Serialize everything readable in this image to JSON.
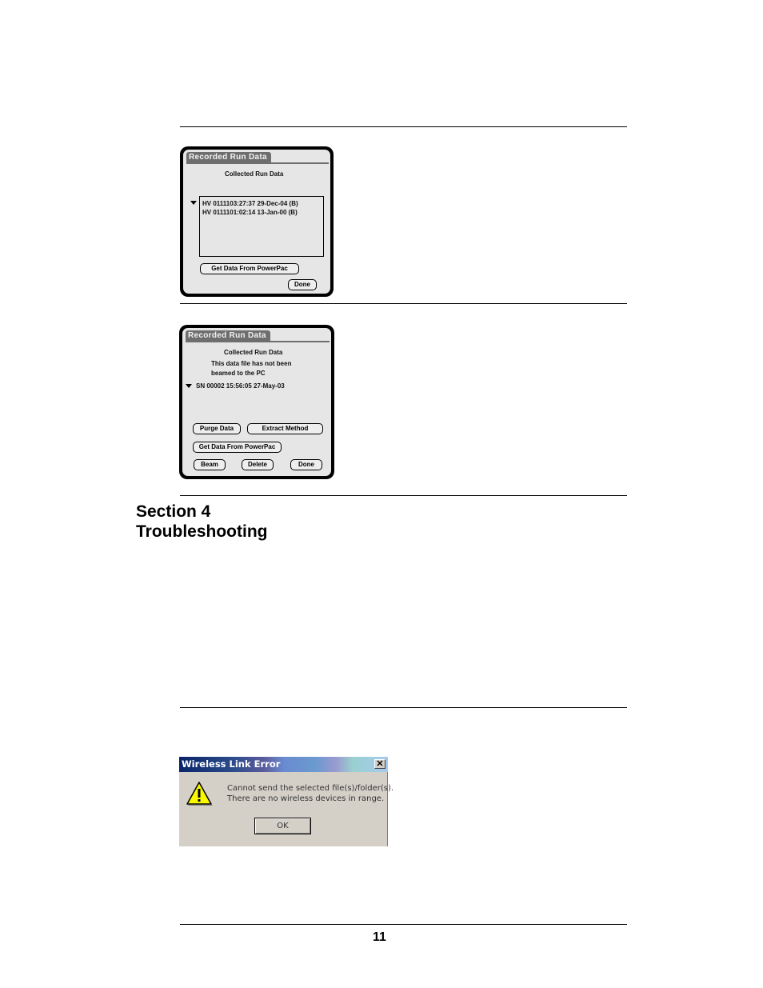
{
  "palm_dialog_1": {
    "title": "Recorded Run Data",
    "subtitle": "Collected Run Data",
    "list_items": [
      "HV 0111103:27:37 29-Dec-04 (B)",
      "HV 0111101:02:14 13-Jan-00 (B)"
    ],
    "get_data_button": "Get Data From PowerPac",
    "done_button": "Done"
  },
  "palm_dialog_2": {
    "title": "Recorded Run Data",
    "subtitle": "Collected Run Data",
    "notice_line1": "This data file has not been",
    "notice_line2": "beamed to the PC",
    "selected_file": "SN 00002  15:56:05 27-May-03",
    "purge_button": "Purge Data",
    "extract_button": "Extract Method",
    "get_data_button": "Get Data From PowerPac",
    "beam_button": "Beam",
    "delete_button": "Delete",
    "done_button": "Done"
  },
  "section": {
    "line1": "Section 4",
    "line2": "Troubleshooting"
  },
  "error_dialog": {
    "title": "Wireless Link Error",
    "close_glyph": "✕",
    "icon": "warning-icon",
    "message_line1": "Cannot send the selected file(s)/folder(s).",
    "message_line2": "There are no wireless devices in range.",
    "ok_button": "OK"
  },
  "page_number": "11"
}
